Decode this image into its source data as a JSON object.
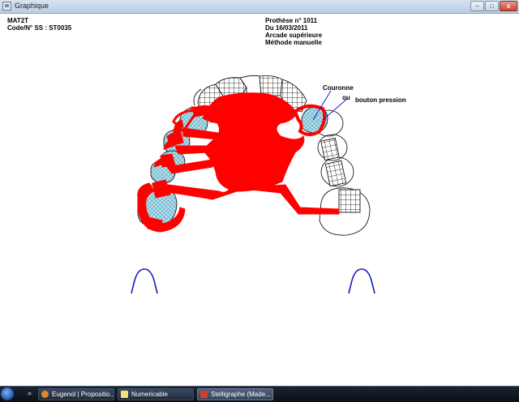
{
  "window": {
    "title": "Graphique",
    "buttons": {
      "minimize": "–",
      "maximize": "□",
      "close": "x"
    }
  },
  "patient": {
    "name": "MAT2T",
    "code": "Code/N° SS : ST0035"
  },
  "prosthesis": {
    "number": "Prothèse n° 1011",
    "date": "Du 16/03/2011",
    "arch": "Arcade supérieure",
    "method": "Méthode manuelle"
  },
  "annotations": {
    "couronne": "Couronne",
    "ou": "ou",
    "bouton": "bouton pression"
  },
  "colors": {
    "framework": "#ff0000",
    "crown_fill": "#aee6f0",
    "arch_marker": "#1a1acc",
    "outline": "#000000"
  },
  "taskbar": {
    "start_icon": "windows-orb-icon",
    "overflow": "»",
    "items": [
      {
        "label": "Eugenol | Propositio...",
        "icon": "firefox-icon",
        "color": "#e8832a",
        "active": false
      },
      {
        "label": "Numericable",
        "icon": "document-icon",
        "color": "#f2e27a",
        "active": false
      },
      {
        "label": "Stelligraphe (Made...",
        "icon": "tooth-app-icon",
        "color": "#d63a2c",
        "active": true
      }
    ]
  }
}
